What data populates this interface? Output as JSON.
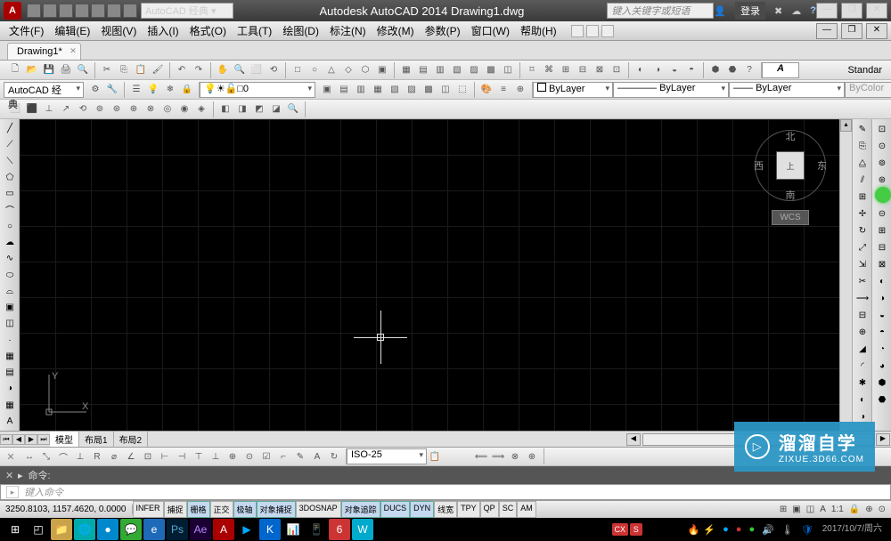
{
  "app": {
    "logo": "A",
    "workspace": "AutoCAD 经典",
    "title": "Autodesk AutoCAD 2014   Drawing1.dwg",
    "search_placeholder": "键入关键字或短语",
    "login": "登录",
    "help_icon": "?"
  },
  "window": {
    "min": "—",
    "max": "❐",
    "close": "✕"
  },
  "menus": [
    "文件(F)",
    "编辑(E)",
    "视图(V)",
    "插入(I)",
    "格式(O)",
    "工具(T)",
    "绘图(D)",
    "标注(N)",
    "修改(M)",
    "参数(P)",
    "窗口(W)",
    "帮助(H)"
  ],
  "filetabs": [
    {
      "name": "Drawing1*"
    }
  ],
  "toolbar1": {
    "workspace_select": "AutoCAD 经典",
    "annot_style": "Standar",
    "annot_A": "A"
  },
  "toolbar2": {
    "layer_color_swatch": "□0",
    "layer": "ByLayer",
    "linetype": "ByLayer",
    "lineweight": "ByLayer",
    "plotstyle": "ByColor"
  },
  "viewcube": {
    "n": "北",
    "s": "南",
    "e": "东",
    "w": "西",
    "face": "上",
    "wcs": "WCS"
  },
  "ucs": {
    "x": "X",
    "y": "Y"
  },
  "model_tabs": [
    "模型",
    "布局1",
    "布局2"
  ],
  "dimstyle": "ISO-25",
  "cmd": {
    "label": "命令:",
    "placeholder": "键入命令"
  },
  "coords": "3250.8103, 1157.4620, 0.0000",
  "status_btns": [
    {
      "t": "INFER",
      "on": false
    },
    {
      "t": "捕捉",
      "on": false
    },
    {
      "t": "栅格",
      "on": true
    },
    {
      "t": "正交",
      "on": false
    },
    {
      "t": "极轴",
      "on": true
    },
    {
      "t": "对象捕捉",
      "on": true
    },
    {
      "t": "3DOSNAP",
      "on": false
    },
    {
      "t": "对象追踪",
      "on": true
    },
    {
      "t": "DUCS",
      "on": true
    },
    {
      "t": "DYN",
      "on": true
    },
    {
      "t": "线宽",
      "on": false
    },
    {
      "t": "TPY",
      "on": false
    },
    {
      "t": "QP",
      "on": false
    },
    {
      "t": "SC",
      "on": false
    },
    {
      "t": "AM",
      "on": false
    }
  ],
  "status_right": {
    "cx": "CX",
    "s": "S"
  },
  "taskbar": {
    "datetime": "2017/10/7/周六",
    "icons": [
      "⊞",
      "□",
      "📁",
      "🌐",
      "🔵",
      "💬",
      "e",
      "Ps",
      "Ae",
      "A",
      "▶",
      "K",
      "📊",
      "📱",
      "6",
      "W"
    ]
  },
  "watermark": {
    "title": "溜溜自学",
    "url": "ZIXUE.3D66.COM"
  }
}
